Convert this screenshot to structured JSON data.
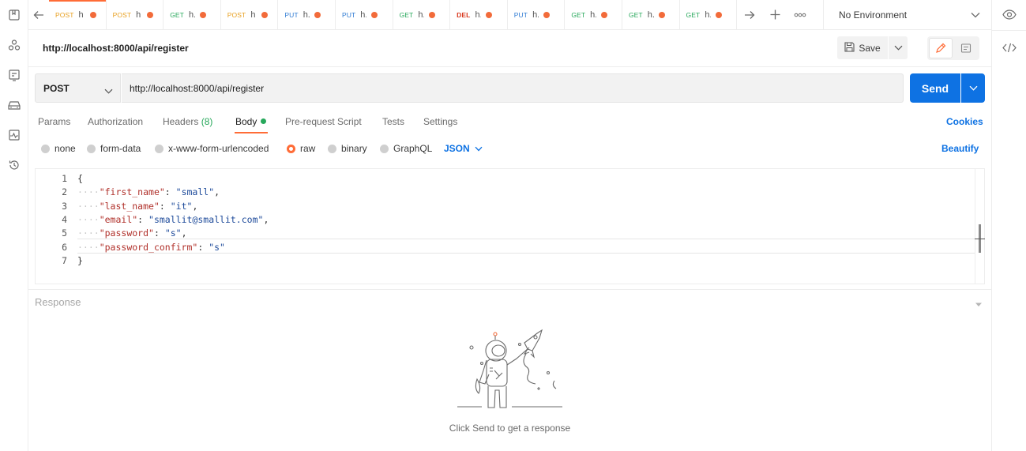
{
  "tabs": [
    {
      "method": "POST",
      "name": "h",
      "cls": "m-post"
    },
    {
      "method": "POST",
      "name": "h",
      "cls": "m-post"
    },
    {
      "method": "GET",
      "name": "h.",
      "cls": "m-get"
    },
    {
      "method": "POST",
      "name": "h",
      "cls": "m-post"
    },
    {
      "method": "PUT",
      "name": "h.",
      "cls": "m-put"
    },
    {
      "method": "PUT",
      "name": "h.",
      "cls": "m-put"
    },
    {
      "method": "GET",
      "name": "h.",
      "cls": "m-get"
    },
    {
      "method": "DEL",
      "name": "h.",
      "cls": "m-del"
    },
    {
      "method": "PUT",
      "name": "h.",
      "cls": "m-put"
    },
    {
      "method": "GET",
      "name": "h.",
      "cls": "m-get"
    },
    {
      "method": "GET",
      "name": "h.",
      "cls": "m-get"
    },
    {
      "method": "GET",
      "name": "h.",
      "cls": "m-get"
    }
  ],
  "environment": "No Environment",
  "request": {
    "title": "http://localhost:8000/api/register",
    "save_label": "Save",
    "method": "POST",
    "url": "http://localhost:8000/api/register",
    "send_label": "Send"
  },
  "request_tabs": {
    "params": "Params",
    "authorization": "Authorization",
    "headers": "Headers",
    "headers_count": "(8)",
    "body": "Body",
    "prerequest": "Pre-request Script",
    "tests": "Tests",
    "settings": "Settings",
    "cookies": "Cookies"
  },
  "body_types": {
    "none": "none",
    "form_data": "form-data",
    "urlencoded": "x-www-form-urlencoded",
    "raw": "raw",
    "binary": "binary",
    "graphql": "GraphQL",
    "format": "JSON",
    "beautify": "Beautify"
  },
  "editor": {
    "line_numbers": [
      "1",
      "2",
      "3",
      "4",
      "5",
      "6",
      "7"
    ],
    "open_brace": "{",
    "close_brace": "}",
    "fields": [
      {
        "key": "\"first_name\"",
        "value": "\"small\"",
        "comma": ","
      },
      {
        "key": "\"last_name\"",
        "value": "\"it\"",
        "comma": ","
      },
      {
        "key": "\"email\"",
        "value": "\"smallit@smallit.com\"",
        "comma": ","
      },
      {
        "key": "\"password\"",
        "value": "\"s\"",
        "comma": ","
      },
      {
        "key": "\"password_confirm\"",
        "value": "\"s\"",
        "comma": ""
      }
    ]
  },
  "response": {
    "label": "Response",
    "empty_message": "Click Send to get a response"
  },
  "colors": {
    "accent": "#ff6c37",
    "primary": "#0e72e3",
    "success": "#27a85b"
  }
}
